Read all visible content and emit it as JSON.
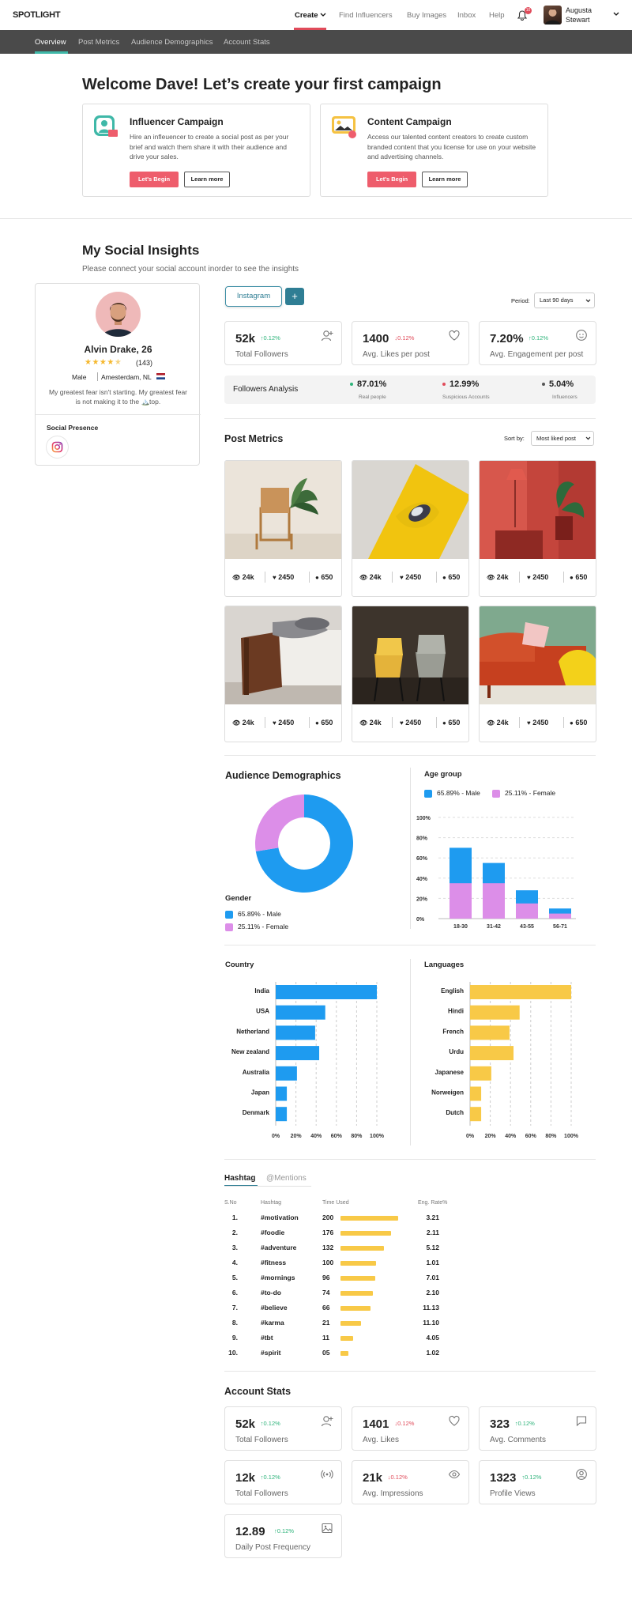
{
  "brand": "SPOTLIGHT",
  "nav": {
    "create": "Create",
    "find": "Find Influencers",
    "buy": "Buy Images",
    "inbox": "Inbox",
    "help": "Help",
    "bell_count": "10",
    "user": "Augusta Stewart"
  },
  "subnav": [
    "Overview",
    "Post Metrics",
    "Audience Demographics",
    "Account Stats"
  ],
  "welcome": {
    "title": "Welcome Dave! Let’s create your first campaign",
    "cards": [
      {
        "title": "Influencer Campaign",
        "desc": "Hire an infleuencer to create a social post as per your brief and watch them share it with their audience and drive your sales.",
        "primary": "Let's Begin",
        "secondary": "Learn more"
      },
      {
        "title": "Content Campaign",
        "desc": "Access our talented content creators to create custom branded content that you license for use on your website and advertising channels.",
        "primary": "Let's Begin",
        "secondary": "Learn more"
      }
    ]
  },
  "insights": {
    "title": "My Social Insights",
    "subtitle": "Please connect your social account inorder to see the insights"
  },
  "profile": {
    "name": "Alvin Drake, 26",
    "rating": "(143)",
    "gender": "Male",
    "location": "Amesterdam, NL",
    "bio": "My greatest fear isn't starting. My greatest fear is not making it to the 🏔️top.",
    "social_title": "Social Presence"
  },
  "account_tab": "Instagram",
  "add_label": "+",
  "period": {
    "label": "Period:",
    "value": "Last 90 days"
  },
  "top_stats": [
    {
      "value": "52k",
      "delta": "↑0.12%",
      "dir": "up",
      "label": "Total Followers",
      "icon": "add-user-icon"
    },
    {
      "value": "1400",
      "delta": "↓0.12%",
      "dir": "down",
      "label": "Avg. Likes per post",
      "icon": "heart-icon"
    },
    {
      "value": "7.20%",
      "delta": "↑0.12%",
      "dir": "up",
      "label": "Avg. Engagement per post",
      "icon": "smile-icon"
    }
  ],
  "followers_analysis": {
    "title": "Followers Analysis",
    "items": [
      {
        "value": "87.01%",
        "label": "Real people",
        "color": "#2db37a"
      },
      {
        "value": "12.99%",
        "label": "Suspicious Accounts",
        "color": "#e04b5a"
      },
      {
        "value": "5.04%",
        "label": "Influencers",
        "color": "#555555"
      }
    ]
  },
  "post_metrics": {
    "title": "Post Metrics",
    "sort_label": "Sort by:",
    "sort_value": "Most liked post",
    "posts": [
      {
        "views": "24k",
        "likes": "2450",
        "comments": "650",
        "scene": "rattan-chair"
      },
      {
        "views": "24k",
        "likes": "2450",
        "comments": "650",
        "scene": "yellow-sofa"
      },
      {
        "views": "24k",
        "likes": "2450",
        "comments": "650",
        "scene": "red-room"
      },
      {
        "views": "24k",
        "likes": "2450",
        "comments": "650",
        "scene": "wood-armchair"
      },
      {
        "views": "24k",
        "likes": "2450",
        "comments": "650",
        "scene": "chairs"
      },
      {
        "views": "24k",
        "likes": "2450",
        "comments": "650",
        "scene": "orange-sofa"
      }
    ]
  },
  "audience": {
    "title": "Audience Demographics",
    "gender_title": "Gender",
    "male_label": "65.89% - Male",
    "female_label": "25.11% - Female",
    "age_title": "Age group",
    "male_color": "#1e9bf0",
    "female_color": "#dc8ee8"
  },
  "country_title": "Country",
  "languages_title": "Languages",
  "chart_data": [
    {
      "type": "pie",
      "title": "Gender",
      "categories": [
        "Male",
        "Female"
      ],
      "values": [
        65.89,
        25.11
      ]
    },
    {
      "type": "bar",
      "title": "Age group",
      "categories": [
        "18-30",
        "31-42",
        "43-55",
        "56-71"
      ],
      "series": [
        {
          "name": "65.89% - Male",
          "values": [
            70,
            55,
            28,
            10
          ]
        },
        {
          "name": "25.11% - Female",
          "values": [
            35,
            35,
            15,
            5
          ]
        }
      ],
      "ylim": [
        0,
        100
      ],
      "yticks": [
        "100%",
        "80%",
        "60%",
        "40%",
        "20%",
        "0%"
      ]
    },
    {
      "type": "bar",
      "orientation": "horizontal",
      "title": "Country",
      "categories": [
        "India",
        "USA",
        "Netherland",
        "New zealand",
        "Australia",
        "Japan",
        "Denmark"
      ],
      "values": [
        100,
        49,
        39,
        43,
        21,
        11,
        11
      ],
      "xlim": [
        0,
        100
      ],
      "xticks": [
        "0%",
        "20%",
        "40%",
        "60%",
        "80%",
        "100%"
      ]
    },
    {
      "type": "bar",
      "orientation": "horizontal",
      "title": "Languages",
      "categories": [
        "English",
        "Hindi",
        "French",
        "Urdu",
        "Japanese",
        "Norweigen",
        "Dutch"
      ],
      "values": [
        100,
        49,
        39,
        43,
        21,
        11,
        11
      ],
      "xlim": [
        0,
        100
      ],
      "xticks": [
        "0%",
        "20%",
        "40%",
        "60%",
        "80%",
        "100%"
      ]
    }
  ],
  "hashtags": {
    "tab_active": "Hashtag",
    "tab_other": "@Mentions",
    "headers": [
      "S.No",
      "Hashtag",
      "Time Used",
      "Eng. Rate%"
    ],
    "rows": [
      {
        "no": "1.",
        "tag": "#motivation",
        "count": "200",
        "pct": 100,
        "rate": "3.21"
      },
      {
        "no": "2.",
        "tag": "#foodie",
        "count": "176",
        "pct": 87,
        "rate": "2.11"
      },
      {
        "no": "3.",
        "tag": "#adventure",
        "count": "132",
        "pct": 75,
        "rate": "5.12"
      },
      {
        "no": "4.",
        "tag": "#fitness",
        "count": "100",
        "pct": 62,
        "rate": "1.01"
      },
      {
        "no": "5.",
        "tag": "#mornings",
        "count": "96",
        "pct": 60,
        "rate": "7.01"
      },
      {
        "no": "6.",
        "tag": "#to-do",
        "count": "74",
        "pct": 56,
        "rate": "2.10"
      },
      {
        "no": "7.",
        "tag": "#believe",
        "count": "66",
        "pct": 52,
        "rate": "11.13"
      },
      {
        "no": "8.",
        "tag": "#karma",
        "count": "21",
        "pct": 36,
        "rate": "11.10"
      },
      {
        "no": "9.",
        "tag": "#tbt",
        "count": "11",
        "pct": 22,
        "rate": "4.05"
      },
      {
        "no": "10.",
        "tag": "#spirit",
        "count": "05",
        "pct": 14,
        "rate": "1.02"
      }
    ]
  },
  "account_stats": {
    "title": "Account Stats",
    "items": [
      {
        "value": "52k",
        "delta": "↑0.12%",
        "dir": "up",
        "label": "Total Followers",
        "icon": "add-user-icon"
      },
      {
        "value": "1401",
        "delta": "↓0.12%",
        "dir": "down",
        "label": "Avg. Likes",
        "icon": "heart-icon"
      },
      {
        "value": "323",
        "delta": "↑0.12%",
        "dir": "up",
        "label": "Avg. Comments",
        "icon": "comment-icon"
      },
      {
        "value": "12k",
        "delta": "↑0.12%",
        "dir": "up",
        "label": "Total Followers",
        "icon": "broadcast-icon"
      },
      {
        "value": "21k",
        "delta": "↓0.12%",
        "dir": "down",
        "label": "Avg. Impressions",
        "icon": "eye-icon"
      },
      {
        "value": "1323",
        "delta": "↑0.12%",
        "dir": "up",
        "label": "Profile Views",
        "icon": "user-circle-icon"
      },
      {
        "value": "12.89",
        "delta": "↑0.12%",
        "dir": "up",
        "label": "Daily Post Frequency",
        "icon": "image-icon"
      }
    ]
  }
}
